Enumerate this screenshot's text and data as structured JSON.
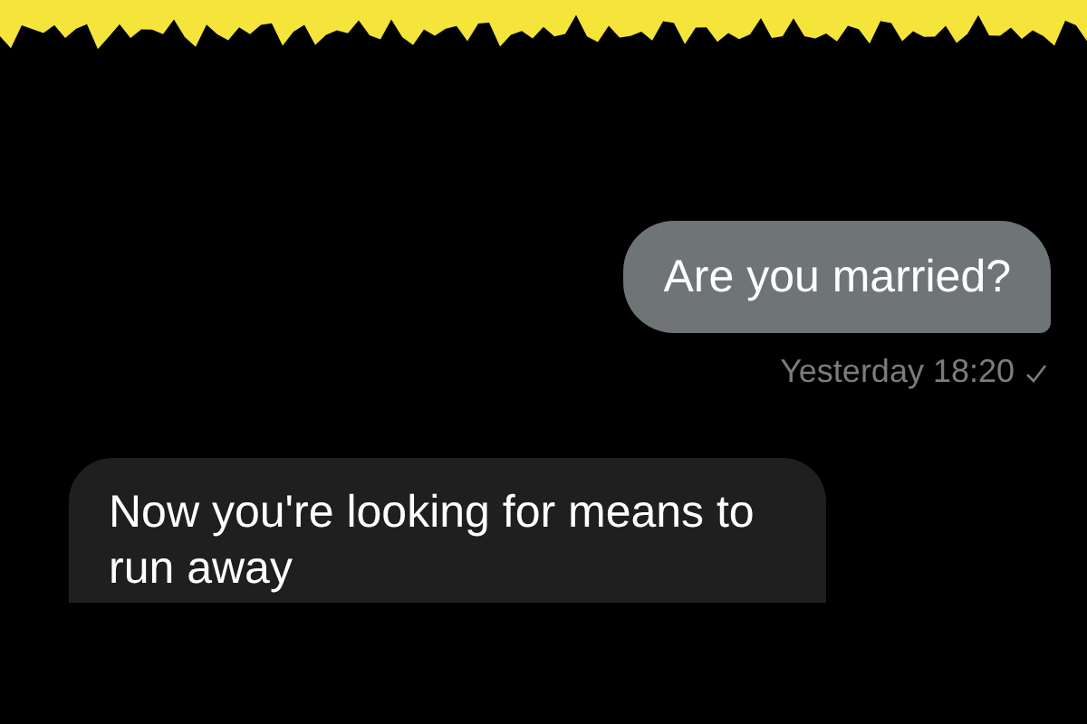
{
  "messages": [
    {
      "kind": "sent",
      "text": "Are you married?",
      "time": "Yesterday 18:20"
    },
    {
      "kind": "received",
      "text": "Now you're looking for means to run away"
    }
  ]
}
